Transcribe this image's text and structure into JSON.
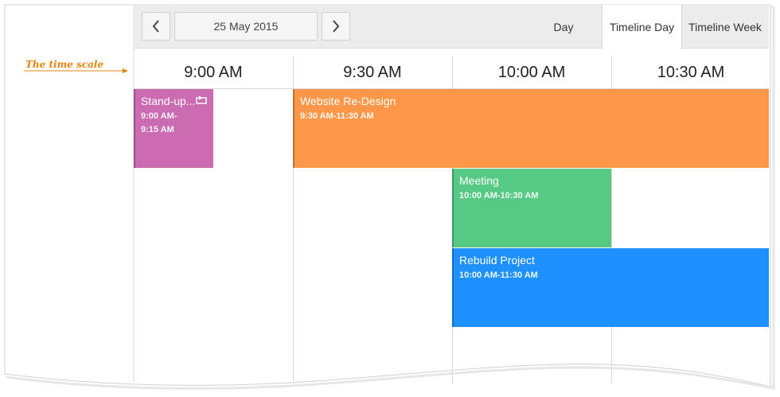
{
  "annotation": {
    "label": "The time scale"
  },
  "toolbar": {
    "date_label": "25 May 2015",
    "views": [
      "Day",
      "Timeline Day",
      "Timeline Week"
    ],
    "active_view": "Timeline Day"
  },
  "time_scale": [
    "9:00 AM",
    "9:30 AM",
    "10:00 AM",
    "10:30 AM"
  ],
  "appointments": [
    {
      "title": "Stand-up...",
      "time_line1": "9:00 AM-",
      "time_line2": "9:15 AM",
      "color": "#cb6bb2",
      "recurring": true
    },
    {
      "title": "Website Re-Design",
      "time": "9:30 AM-11:30 AM",
      "color": "#fe9748"
    },
    {
      "title": "Meeting",
      "time": "10:00 AM-10:30 AM",
      "color": "#56ca85"
    },
    {
      "title": "Rebuild Project",
      "time": "10:00 AM-11:30 AM",
      "color": "#1e90ff"
    }
  ]
}
